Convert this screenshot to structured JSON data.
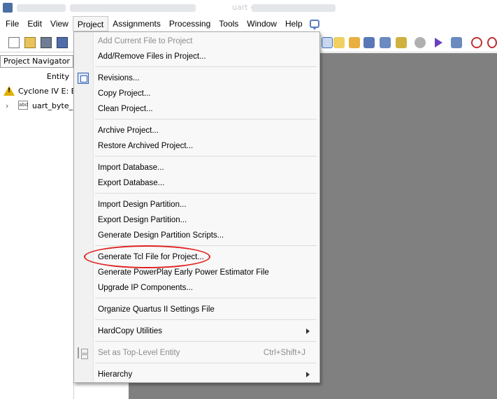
{
  "window": {
    "title": "uart -"
  },
  "menubar": {
    "items": [
      {
        "label": "File"
      },
      {
        "label": "Edit"
      },
      {
        "label": "View"
      },
      {
        "label": "Project"
      },
      {
        "label": "Assignments"
      },
      {
        "label": "Processing"
      },
      {
        "label": "Tools"
      },
      {
        "label": "Window"
      },
      {
        "label": "Help"
      }
    ],
    "active": "Project",
    "help_icon": "chat-help-icon"
  },
  "toolbar": {
    "icons": [
      "new-file-icon",
      "open-folder-icon",
      "save-icon",
      "save-all-icon",
      "pin-icon",
      "pencil-icon",
      "compile-icon",
      "analysis-icon",
      "synthesis-icon",
      "stop-icon",
      "run-icon",
      "timing-icon",
      "clock-icon",
      "stopwatch-icon"
    ]
  },
  "navigator": {
    "header": "Project Navigator",
    "column": "Entity",
    "rows": [
      {
        "icon": "warning-icon",
        "label": "Cyclone IV E: EP"
      },
      {
        "icon": "entity-icon",
        "label": "uart_byte_r"
      }
    ]
  },
  "project_menu": {
    "items": [
      {
        "label": "Add Current File to Project",
        "disabled": true
      },
      {
        "label": "Add/Remove Files in Project..."
      },
      {
        "label": "Revisions...",
        "icon": "revisions-icon"
      },
      {
        "label": "Copy Project..."
      },
      {
        "label": "Clean Project..."
      },
      {
        "label": "Archive Project..."
      },
      {
        "label": "Restore Archived Project..."
      },
      {
        "label": "Import Database..."
      },
      {
        "label": "Export Database..."
      },
      {
        "label": "Import Design Partition..."
      },
      {
        "label": "Export Design Partition..."
      },
      {
        "label": "Generate Design Partition Scripts..."
      },
      {
        "label": "Generate Tcl File for Project...",
        "highlighted": true
      },
      {
        "label": "Generate PowerPlay Early Power Estimator File"
      },
      {
        "label": "Upgrade IP Components..."
      },
      {
        "label": "Organize Quartus II Settings File"
      },
      {
        "label": "HardCopy Utilities",
        "submenu": true
      },
      {
        "label": "Set as Top-Level Entity",
        "shortcut": "Ctrl+Shift+J",
        "disabled": true,
        "icon": "hierarchy-tree-icon"
      },
      {
        "label": "Hierarchy",
        "submenu": true
      }
    ]
  },
  "colors": {
    "workspace": "#808080",
    "highlight": "#e02020"
  }
}
